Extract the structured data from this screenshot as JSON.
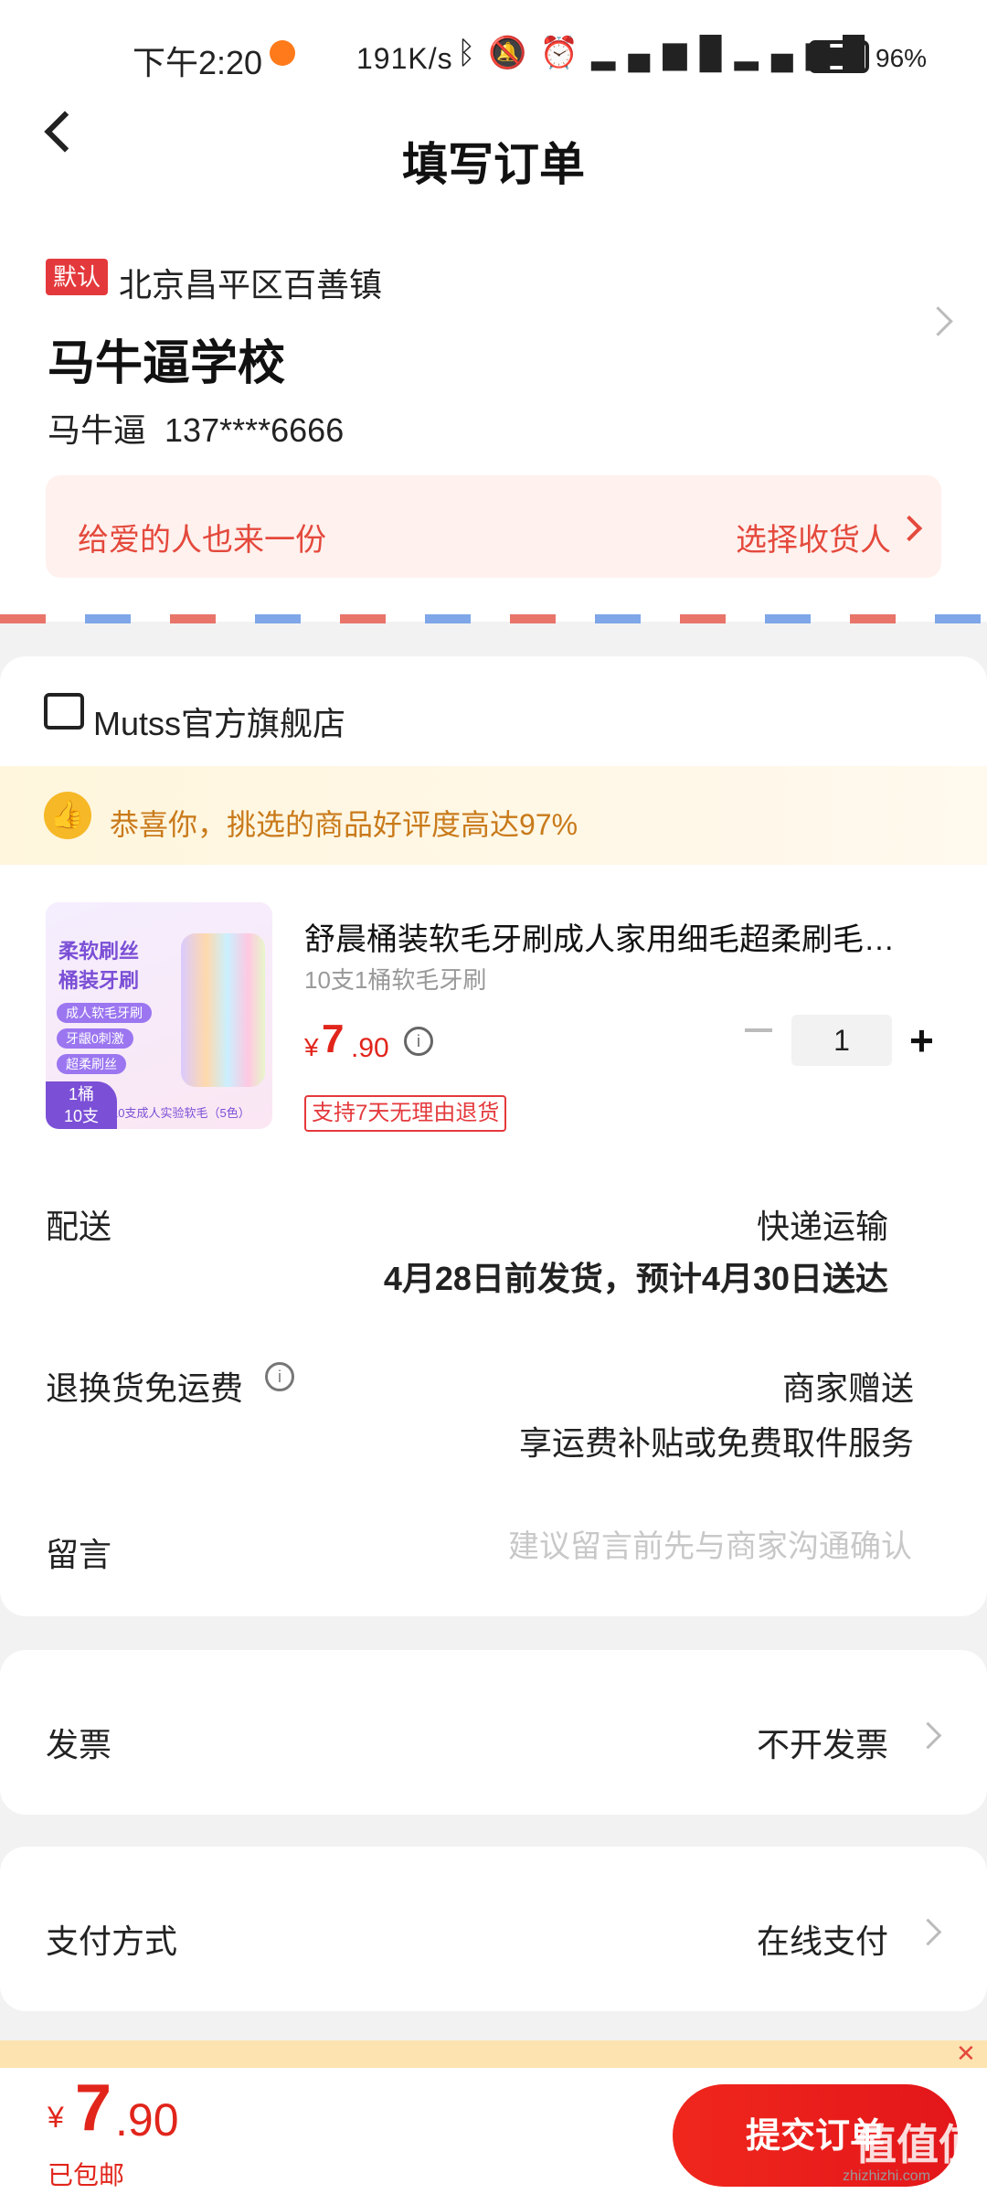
{
  "status_bar": {
    "time": "下午2:20",
    "network_speed": "191K/s",
    "icons": [
      "bluetooth-icon",
      "mute-icon",
      "alarm-icon",
      "hd-icon",
      "signal-4g-icon",
      "hd-icon",
      "signal-4g-icon"
    ],
    "battery_pct": "96%",
    "battery_level": 0.96
  },
  "header": {
    "title": "填写订单"
  },
  "address": {
    "default_tag": "默认",
    "region": "北京昌平区百善镇",
    "detail": "马牛逼学校",
    "contact_name": "马牛逼",
    "contact_phone": "137****6666",
    "gift_text": "给爱的人也来一份",
    "choose_recipient": "选择收货人"
  },
  "store": {
    "name": "Mutss官方旗舰店",
    "praise_text": "恭喜你，挑选的商品好评度高达97%"
  },
  "product": {
    "image_title_line1": "柔软刷丝",
    "image_title_line2": "桶装牙刷",
    "image_pills": [
      "成人软毛牙刷",
      "牙龈0刺激",
      "超柔刷丝"
    ],
    "image_badge_line1": "1桶",
    "image_badge_line2": "10支",
    "image_caption": "10支成人实验软毛（5色）",
    "title": "舒晨桶装软毛牙刷成人家用细毛超柔刷毛…",
    "spec": "10支1桶软毛牙刷",
    "price_symbol": "¥",
    "price_int": "7",
    "price_dec": ".90",
    "quantity": "1",
    "return_tag": "支持7天无理由退货"
  },
  "delivery": {
    "label": "配送",
    "method": "快递运输",
    "time": "4月28日前发货，预计4月30日送达"
  },
  "freight": {
    "label": "退换货免运费",
    "value": "商家赠送",
    "desc": "享运费补贴或免费取件服务"
  },
  "message": {
    "label": "留言",
    "placeholder": "建议留言前先与商家沟通确认"
  },
  "invoice": {
    "label": "发票",
    "value": "不开发票"
  },
  "payment": {
    "label": "支付方式",
    "value": "在线支付"
  },
  "bottom": {
    "total_symbol": "¥",
    "total_int": "7",
    "total_dec": ".90",
    "shipping_note": "已包邮",
    "submit_label": "提交订单",
    "close_symbol": "✕"
  },
  "watermark": {
    "text": "值值值",
    "url": "zhizhizhi.com"
  },
  "colors": {
    "accent": "#e1251b",
    "praise": "#c97a1a",
    "gift_bg": "#fff1ee"
  }
}
